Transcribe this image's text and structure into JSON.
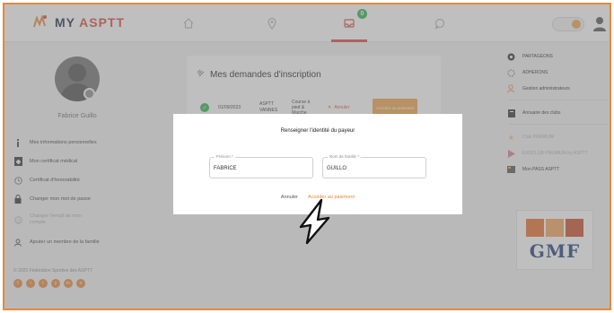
{
  "app": {
    "logo_text": "MY ",
    "logo_accent": "ASPTT"
  },
  "topnav": {
    "items": [
      {
        "icon": "home-icon"
      },
      {
        "icon": "location-pin-icon"
      },
      {
        "icon": "inbox-icon",
        "badge": "0",
        "active": true
      },
      {
        "icon": "chat-icon"
      }
    ],
    "toggle_icon": "notification-toggle",
    "user_icon": "user-icon"
  },
  "profile": {
    "name": "Fabrice Guillo"
  },
  "left_menu": [
    {
      "label": "Mes informations personnelles",
      "icon": "info-icon"
    },
    {
      "label": "Mon certificat médical",
      "icon": "medical-file-icon"
    },
    {
      "label": "Certificat d'honorabilité",
      "icon": "clock-icon"
    },
    {
      "label": "Changer mon mot de passe",
      "icon": "lock-icon"
    },
    {
      "label": "Changer l'email de mon compte",
      "icon": "email-icon",
      "dim": true
    },
    {
      "label": "Ajouter un membre de la famille",
      "icon": "add-member-icon"
    }
  ],
  "footer": {
    "copyright": "© 2023 Fédération Sportive des ASPTT"
  },
  "socials": [
    "f",
    "i",
    "t",
    "y",
    "in",
    "e"
  ],
  "inscriptions": {
    "title": "Mes demandes d'inscription",
    "rows": [
      {
        "date": "01/09/2023",
        "club": "ASPTT VANNES",
        "activity": "Course à pied & Marche",
        "cancel": "Annuler",
        "pay": "Accéder au paiement"
      }
    ]
  },
  "right_menu": [
    {
      "label": "PARTAGEONS",
      "icon": "share-icon"
    },
    {
      "label": "ADHERONS",
      "icon": "gear-icon"
    },
    {
      "label": "Gestion administrateurs",
      "icon": "admin-icon",
      "sep_after": true
    },
    {
      "label": "Annuaire des clubs",
      "icon": "book-icon",
      "sep_after": true
    },
    {
      "label": "Club PREMIUM",
      "icon": "star-icon",
      "dim": true
    },
    {
      "label": "EXOCLUB PREMIUM by ASPTT",
      "icon": "play-icon",
      "dim": true
    },
    {
      "label": "Mon PASS ASPTT",
      "icon": "pass-icon"
    }
  ],
  "ad": {
    "text": "GMF"
  },
  "modal": {
    "title": "Renseigner l'identité du payeur",
    "first_name_label": "Prénom *",
    "first_name_value": "FABRICE",
    "last_name_label": "Nom de famille *",
    "last_name_value": "GUILLO",
    "cancel_label": "Annuler",
    "confirm_label": "Accéder au paiement"
  },
  "colors": {
    "accent": "#e8883a",
    "brand_red": "#d8473a",
    "success": "#2bb24c",
    "ad_blue": "#1b3a7a"
  }
}
